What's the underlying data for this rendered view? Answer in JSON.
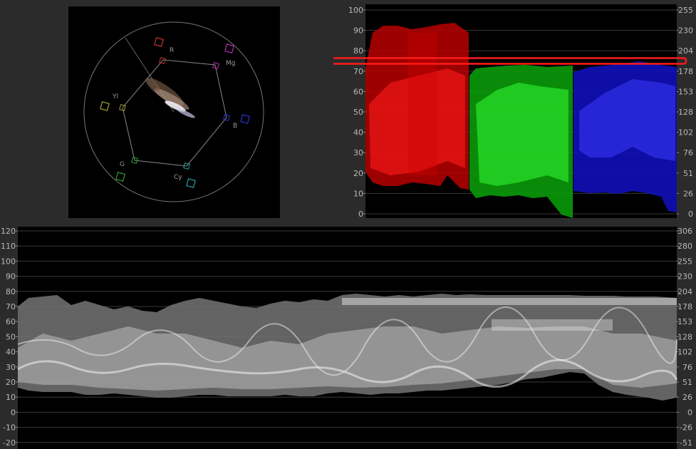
{
  "theme": {
    "background": "#2b2b2b",
    "scope_bg": "#000000",
    "grid": "#3a3a3a",
    "text": "#b9b9b9",
    "red": "#e01010",
    "green": "#14d414",
    "blue": "#1a1ae8",
    "luma": "#d9d9d9",
    "highlight": "#ff1a1a"
  },
  "vectorscope": {
    "targets": [
      {
        "label": "R",
        "color": "#c83030"
      },
      {
        "label": "Mg",
        "color": "#b030b0"
      },
      {
        "label": "B",
        "color": "#3030d0"
      },
      {
        "label": "Cy",
        "color": "#20a0a0"
      },
      {
        "label": "G",
        "color": "#30a030"
      },
      {
        "label": "Yl",
        "color": "#a0a030"
      }
    ]
  },
  "parade": {
    "left_ticks": [
      "100",
      "90",
      "80",
      "70",
      "60",
      "50",
      "40",
      "30",
      "20",
      "10",
      "0"
    ],
    "right_ticks": [
      "255",
      "230",
      "204",
      "178",
      "153",
      "128",
      "102",
      "76",
      "51",
      "26",
      "0"
    ],
    "highlight_level": 75
  },
  "waveform": {
    "left_ticks": [
      "120",
      "110",
      "100",
      "90",
      "80",
      "70",
      "60",
      "50",
      "40",
      "30",
      "20",
      "10",
      "0",
      "-10",
      "-20"
    ],
    "right_ticks": [
      "306",
      "280",
      "255",
      "230",
      "204",
      "178",
      "153",
      "128",
      "102",
      "76",
      "51",
      "26",
      "0",
      "-26",
      "-51"
    ]
  }
}
